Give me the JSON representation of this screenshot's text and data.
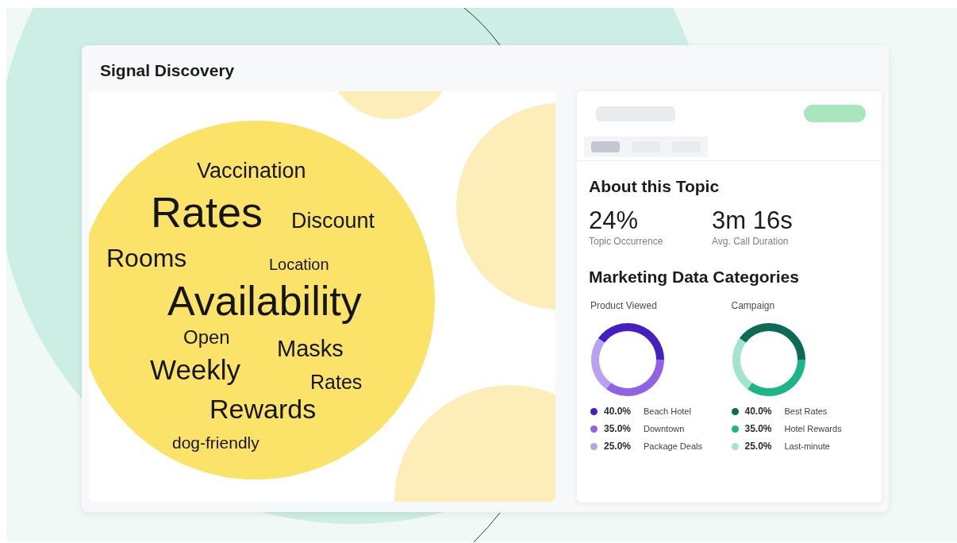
{
  "header": {
    "title": "Signal Discovery"
  },
  "word_cloud": {
    "words": [
      "Vaccination",
      "Rates",
      "Discount",
      "Rooms",
      "Location",
      "Availability",
      "Open",
      "Masks",
      "Weekly",
      "Rates",
      "Rewards",
      "dog-friendly"
    ]
  },
  "detail_panel": {
    "placeholder_tabs": [
      {
        "selected": true
      },
      {
        "selected": false
      },
      {
        "selected": false
      }
    ],
    "about": {
      "title": "About this Topic",
      "stats": [
        {
          "value": "24%",
          "label": "Topic Occurrence"
        },
        {
          "value": "3m 16s",
          "label": "Avg. Call Duration"
        }
      ]
    },
    "marketing": {
      "title": "Marketing Data Categories",
      "charts": [
        {
          "title": "Product Viewed",
          "chart_data": {
            "type": "donut",
            "categories": [
              "Beach Hotel",
              "Downtown",
              "Package Deals"
            ],
            "values": [
              40,
              35,
              25
            ]
          },
          "legend": [
            {
              "value": "40.0%",
              "color": "#4520c0"
            },
            {
              "value": "35.0%",
              "color": "#8f62e8"
            },
            {
              "value": "25.0%",
              "color": "#b8a2ef"
            }
          ]
        },
        {
          "title": "Campaign",
          "chart_data": {
            "type": "donut",
            "categories": [
              "Best Rates",
              "Hotel Rewards",
              "Last-minute"
            ],
            "values": [
              40,
              35,
              25
            ]
          },
          "legend": [
            {
              "value": "40.0%",
              "color": "#0d6a54"
            },
            {
              "value": "35.0%",
              "color": "#1db489"
            },
            {
              "value": "25.0%",
              "color": "#a4e3d0"
            }
          ]
        }
      ]
    }
  }
}
